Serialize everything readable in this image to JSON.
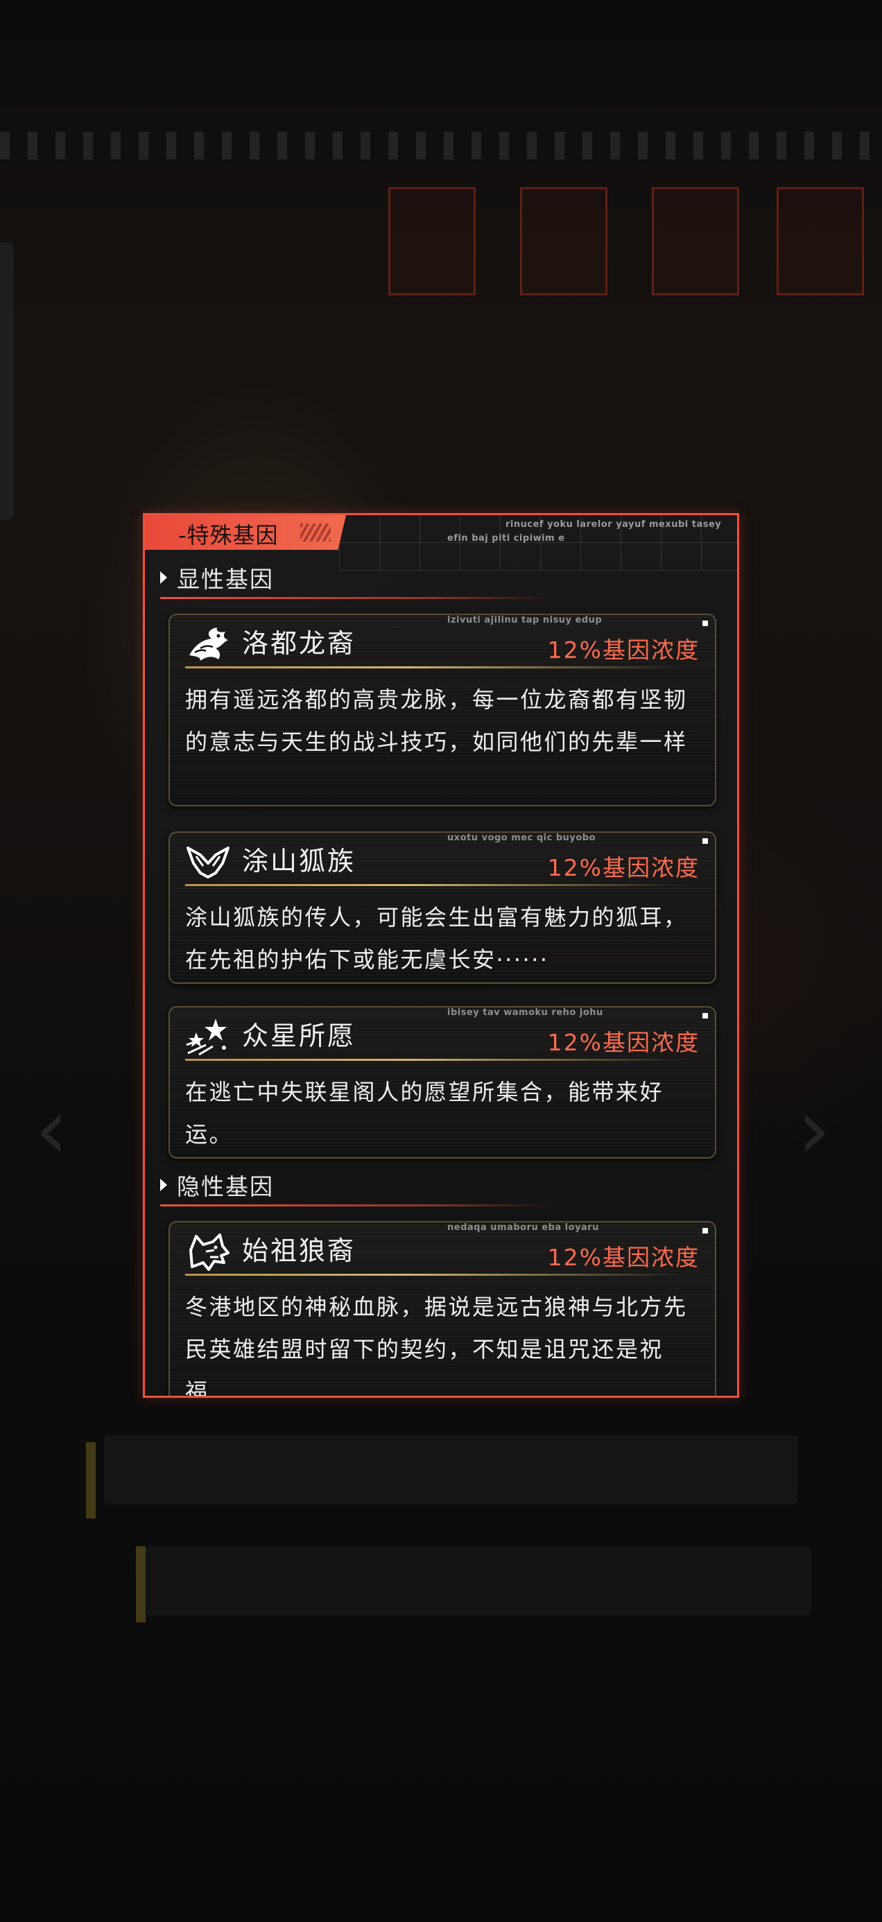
{
  "panel": {
    "title": "-特殊基因",
    "deco_text_1": "rinucef yoku larelor yayuf mexubi tasey",
    "deco_text_2": "efin baj piti cipiwim e"
  },
  "sections": [
    {
      "label": "显性基因",
      "genes": [
        {
          "name": "洛都龙裔",
          "icon": "dragon-icon",
          "code": "izivuti ajilinu tap nisuy edup",
          "level": "12%基因浓度",
          "desc": "拥有遥远洛都的高贵龙脉，每一位龙裔都有坚韧的意志与天生的战斗技巧，如同他们的先辈一样"
        },
        {
          "name": "涂山狐族",
          "icon": "fox-icon",
          "code": "uxotu vogo mec qic buyobo",
          "level": "12%基因浓度",
          "desc": "涂山狐族的传人，可能会生出富有魅力的狐耳，在先祖的护佑下或能无虞长安······"
        },
        {
          "name": "众星所愿",
          "icon": "stars-icon",
          "code": "ibisey tav wamoku reho johu",
          "level": "12%基因浓度",
          "desc": "在逃亡中失联星阁人的愿望所集合，能带来好运。"
        }
      ]
    },
    {
      "label": "隐性基因",
      "genes": [
        {
          "name": "始祖狼裔",
          "icon": "wolf-icon",
          "code": "nedaqa umaboru eba loyaru",
          "level": "12%基因浓度",
          "desc": "冬港地区的神秘血脉，据说是远古狼神与北方先民英雄结盟时留下的契约，不知是诅咒还是祝福……"
        }
      ]
    }
  ],
  "colors": {
    "accent": "#f0513a",
    "level_text": "#ff6a4e",
    "gold_line": "#d2aa50"
  }
}
